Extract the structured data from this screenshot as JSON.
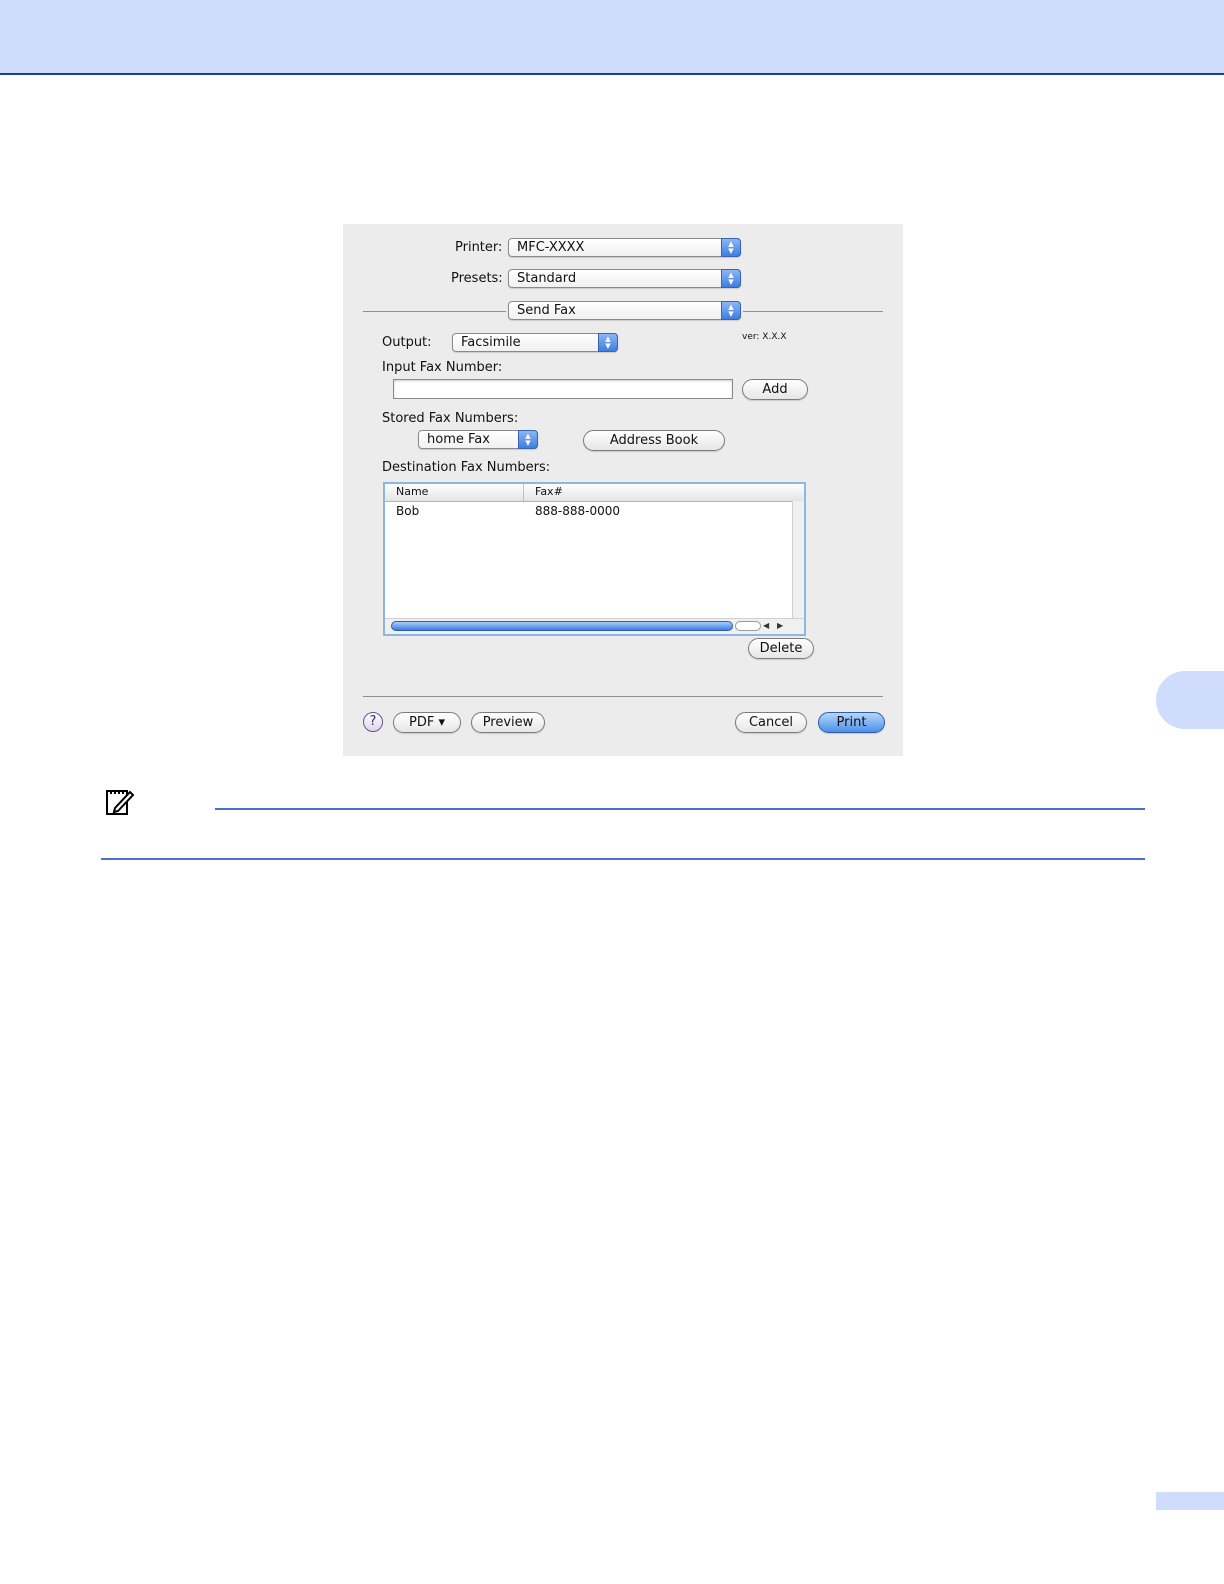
{
  "dialog": {
    "printer": {
      "label": "Printer:",
      "value": "MFC-XXXX"
    },
    "presets": {
      "label": "Presets:",
      "value": "Standard"
    },
    "panel": {
      "value": "Send Fax"
    },
    "output": {
      "label": "Output:",
      "value": "Facsimile"
    },
    "version": "ver: X.X.X",
    "input_fax": {
      "label": "Input Fax Number:",
      "value": "",
      "add_label": "Add"
    },
    "stored_fax": {
      "label": "Stored Fax Numbers:",
      "value": "home Fax",
      "address_book_label": "Address Book"
    },
    "destination": {
      "label": "Destination Fax Numbers:",
      "columns": [
        "Name",
        "Fax#"
      ],
      "rows": [
        {
          "name": "Bob",
          "fax": "888-888-0000"
        }
      ]
    },
    "delete_label": "Delete",
    "footer": {
      "help": "?",
      "pdf_label": "PDF ▾",
      "preview_label": "Preview",
      "cancel_label": "Cancel",
      "print_label": "Print"
    }
  },
  "colors": {
    "header_band": "#cfdcfc",
    "rule": "#4b6fd1",
    "accent": "#3d7ee0"
  },
  "icons": {
    "note": "note-pencil-icon"
  }
}
